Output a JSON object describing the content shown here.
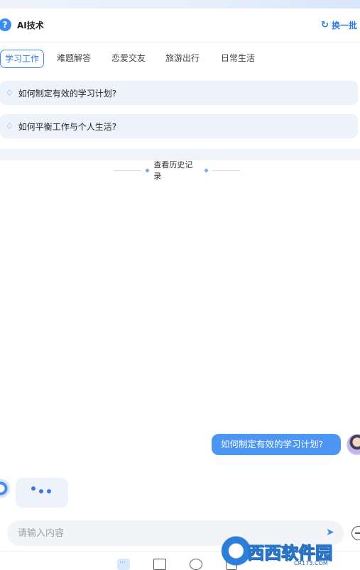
{
  "header": {
    "icon": "?",
    "title": "AI技术",
    "refresh_label": "换一批"
  },
  "tabs": [
    {
      "label": "学习工作",
      "active": true
    },
    {
      "label": "难题解答",
      "active": false
    },
    {
      "label": "恋爱交友",
      "active": false
    },
    {
      "label": "旅游出行",
      "active": false
    },
    {
      "label": "日常生活",
      "active": false
    }
  ],
  "suggestions": [
    {
      "text": "如何制定有效的学习计划?"
    },
    {
      "text": "如何平衡工作与个人生活?"
    }
  ],
  "history": {
    "label": "查看历史记录"
  },
  "chat": {
    "user_message": "如何制定有效的学习计划?",
    "bot_state": "typing"
  },
  "input": {
    "placeholder": "请输入内容"
  },
  "bottom_nav": [
    {
      "icon": "chat-icon",
      "active": true
    },
    {
      "icon": "bookmark-icon",
      "active": false
    },
    {
      "icon": "palette-icon",
      "active": false
    },
    {
      "icon": "robot-icon",
      "active": false
    }
  ],
  "watermark": {
    "brand": "西西软件园",
    "url": "CR173.COM"
  },
  "colors": {
    "accent": "#3b8cf0",
    "suggestion_bg": "#eef3fb",
    "user_bubble": "#4c95f3"
  }
}
